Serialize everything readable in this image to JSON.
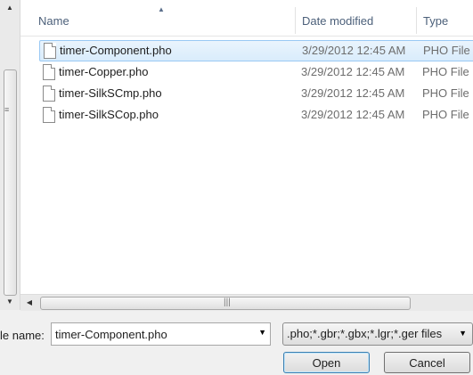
{
  "columns": {
    "name": "Name",
    "date_modified": "Date modified",
    "type": "Type"
  },
  "files": [
    {
      "name": "timer-Component.pho",
      "date": "3/29/2012 12:45 AM",
      "type": "PHO File",
      "selected": true
    },
    {
      "name": "timer-Copper.pho",
      "date": "3/29/2012 12:45 AM",
      "type": "PHO File",
      "selected": false
    },
    {
      "name": "timer-SilkSCmp.pho",
      "date": "3/29/2012 12:45 AM",
      "type": "PHO File",
      "selected": false
    },
    {
      "name": "timer-SilkSCop.pho",
      "date": "3/29/2012 12:45 AM",
      "type": "PHO File",
      "selected": false
    }
  ],
  "footer": {
    "file_name_label": "le name:",
    "file_name_value": "timer-Component.pho",
    "filter_value": ".pho;*.gbr;*.gbx;*.lgr;*.ger files",
    "open_label": "Open",
    "cancel_label": "Cancel"
  },
  "icons": {
    "up": "▲",
    "down": "▼",
    "left": "◀",
    "grip_v": "≡",
    "grip_h": "|||"
  }
}
